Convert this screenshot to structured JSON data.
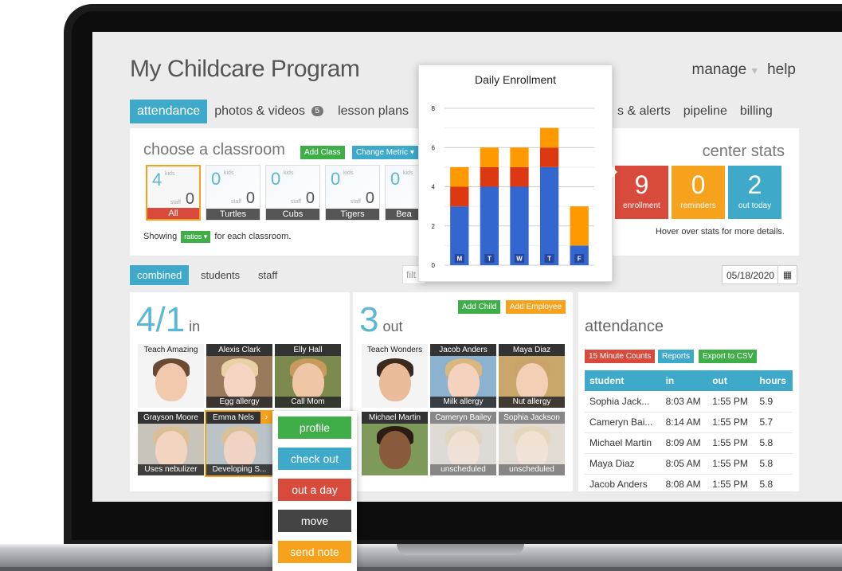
{
  "app": {
    "title": "My Childcare Program"
  },
  "topnav": {
    "manage": "manage",
    "help": "help"
  },
  "tabs": {
    "attendance": "attendance",
    "photos": "photos & videos",
    "photos_badge": "5",
    "lesson": "lesson plans",
    "alerts": "s & alerts",
    "pipeline": "pipeline",
    "billing": "billing"
  },
  "classroom": {
    "title": "choose a classroom",
    "add_class": "Add Class",
    "change_metric": "Change Metric",
    "kids_label": "kids",
    "staff_label": "staff",
    "rooms": [
      {
        "name": "All",
        "kids": "4",
        "staff": "0"
      },
      {
        "name": "Turtles",
        "kids": "0",
        "staff": "0"
      },
      {
        "name": "Cubs",
        "kids": "0",
        "staff": "0"
      },
      {
        "name": "Tigers",
        "kids": "0",
        "staff": "0"
      },
      {
        "name": "Bea",
        "kids": "0",
        "staff": ""
      }
    ],
    "showing_prefix": "Showing",
    "showing_select": "ratios",
    "showing_suffix": "for each classroom."
  },
  "center_stats": {
    "title": "center stats",
    "enrollment": {
      "value": "9",
      "label": "enrollment"
    },
    "reminders": {
      "value": "0",
      "label": "reminders"
    },
    "out_today": {
      "value": "2",
      "label": "out today"
    },
    "hover_hint": "Hover over stats for more details."
  },
  "filter": {
    "combined": "combined",
    "students": "students",
    "staff": "staff",
    "filter_placeholder": "filt",
    "date": "05/18/2020"
  },
  "in_panel": {
    "count": "4/1",
    "suffix": "in"
  },
  "out_panel": {
    "count": "3",
    "suffix": "out",
    "add_child": "Add Child",
    "add_employee": "Add Employee"
  },
  "people_in": [
    {
      "name": "Teach Amazing",
      "note": ""
    },
    {
      "name": "Alexis Clark",
      "note": "Egg allergy"
    },
    {
      "name": "Elly Hall",
      "note": "Call Mom"
    },
    {
      "name": "Grayson Moore",
      "note": "Uses nebulizer"
    },
    {
      "name": "Emma Nels",
      "note": "Developing S..."
    }
  ],
  "people_out": [
    {
      "name": "Teach Wonders",
      "note": ""
    },
    {
      "name": "Jacob Anders",
      "note": "Milk allergy"
    },
    {
      "name": "Maya Diaz",
      "note": "Nut allergy"
    },
    {
      "name": "Michael Martin",
      "note": ""
    },
    {
      "name": "Cameryn Bailey",
      "note": "unscheduled"
    },
    {
      "name": "Sophia Jackson",
      "note": "unscheduled"
    }
  ],
  "attendance": {
    "title": "attendance",
    "btn_15": "15 Minute Counts",
    "btn_reports": "Reports",
    "btn_export": "Export to CSV",
    "headers": [
      "student",
      "in",
      "out",
      "hours"
    ],
    "rows": [
      [
        "Sophia Jack...",
        "8:03 AM",
        "1:55 PM",
        "5.9"
      ],
      [
        "Cameryn Bai...",
        "8:14 AM",
        "1:55 PM",
        "5.7"
      ],
      [
        "Michael Martin",
        "8:09 AM",
        "1:55 PM",
        "5.8"
      ],
      [
        "Maya Diaz",
        "8:05 AM",
        "1:55 PM",
        "5.8"
      ],
      [
        "Jacob Anders",
        "8:08 AM",
        "1:55 PM",
        "5.8"
      ]
    ]
  },
  "context_menu": {
    "profile": "profile",
    "check_out": "check out",
    "out_a_day": "out a day",
    "move": "move",
    "send_note": "send note"
  },
  "colors": {
    "accent": "#3ea9c9",
    "green": "#3fae49",
    "orange": "#f6a21c",
    "red": "#d84a3c",
    "dark": "#444444",
    "bar_blue": "#3466cf",
    "bar_red": "#dc3912",
    "bar_orange": "#ff9900"
  },
  "chart_data": {
    "type": "bar",
    "stacked": true,
    "title": "Daily Enrollment",
    "categories": [
      "M",
      "T",
      "W",
      "T",
      "F"
    ],
    "series": [
      {
        "values": [
          3,
          4,
          4,
          5,
          1
        ],
        "color": "#3466cf"
      },
      {
        "values": [
          1,
          1,
          1,
          1,
          0
        ],
        "color": "#dc3912"
      },
      {
        "values": [
          1,
          1,
          1,
          1,
          2
        ],
        "color": "#ff9900"
      }
    ],
    "ylim": [
      0,
      8
    ],
    "yticks": [
      "0",
      "2",
      "4",
      "6",
      "8"
    ],
    "grid": true
  }
}
